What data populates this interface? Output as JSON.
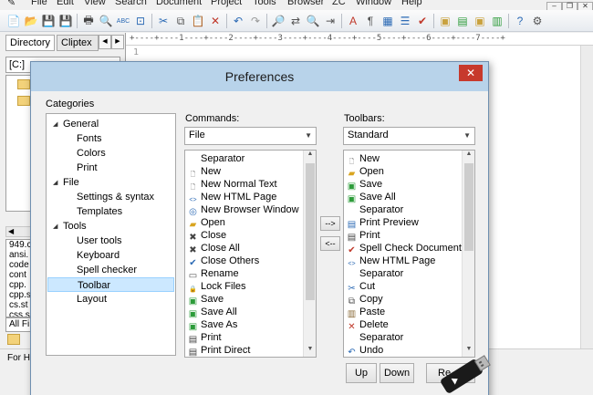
{
  "menu": [
    "File",
    "Edit",
    "View",
    "Search",
    "Document",
    "Project",
    "Tools",
    "Browser",
    "ZC",
    "Window",
    "Help"
  ],
  "window_controls": [
    "–",
    "❐",
    "✕"
  ],
  "left_pane": {
    "tabs": [
      "Directory",
      "Cliptex"
    ],
    "drive": "[C:]",
    "files": [
      "949.c",
      "ansi.",
      "code",
      "cont",
      "cpp.",
      "cpp.s",
      "cs.st",
      "css.s"
    ],
    "filter": "All Fi",
    "status": "For H"
  },
  "editor": {
    "ruler": "+----+----1----+----2----+----3----+----4----+----5----+----6----+----7----+",
    "line_number": "1"
  },
  "dialog": {
    "title": "Preferences",
    "close": "✕",
    "categories_label": "Categories",
    "categories": [
      {
        "label": "General",
        "level": 0,
        "expanded": true
      },
      {
        "label": "Fonts",
        "level": 1
      },
      {
        "label": "Colors",
        "level": 1
      },
      {
        "label": "Print",
        "level": 1
      },
      {
        "label": "File",
        "level": 0,
        "expanded": true
      },
      {
        "label": "Settings & syntax",
        "level": 1
      },
      {
        "label": "Templates",
        "level": 1
      },
      {
        "label": "Tools",
        "level": 0,
        "expanded": true
      },
      {
        "label": "User tools",
        "level": 1
      },
      {
        "label": "Keyboard",
        "level": 1
      },
      {
        "label": "Spell checker",
        "level": 1
      },
      {
        "label": "Toolbar",
        "level": 1,
        "selected": true
      },
      {
        "label": "Layout",
        "level": 1
      }
    ],
    "commands_label": "Commands:",
    "commands_combo": "File",
    "commands": [
      {
        "label": "Separator",
        "icon": ""
      },
      {
        "label": "New",
        "icon": "new-icon"
      },
      {
        "label": "New Normal Text",
        "icon": "new-text-icon"
      },
      {
        "label": "New HTML Page",
        "icon": "html-icon"
      },
      {
        "label": "New Browser Window",
        "icon": "browser-icon"
      },
      {
        "label": "Open",
        "icon": "open-folder-icon"
      },
      {
        "label": "Close",
        "icon": "close-icon"
      },
      {
        "label": "Close All",
        "icon": "close-all-icon"
      },
      {
        "label": "Close Others",
        "icon": "close-others-icon"
      },
      {
        "label": "Rename",
        "icon": "rename-icon"
      },
      {
        "label": "Lock Files",
        "icon": "lock-icon"
      },
      {
        "label": "Save",
        "icon": "save-icon"
      },
      {
        "label": "Save All",
        "icon": "save-all-icon"
      },
      {
        "label": "Save As",
        "icon": "save-as-icon"
      },
      {
        "label": "Print",
        "icon": "print-icon"
      },
      {
        "label": "Print Direct",
        "icon": "print-direct-icon"
      }
    ],
    "add_button": "-->",
    "remove_button": "<--",
    "toolbars_label": "Toolbars:",
    "toolbars_combo": "Standard",
    "toolbar_items": [
      {
        "label": "New",
        "icon": "new-icon"
      },
      {
        "label": "Open",
        "icon": "open-folder-icon"
      },
      {
        "label": "Save",
        "icon": "save-icon"
      },
      {
        "label": "Save All",
        "icon": "save-all-icon"
      },
      {
        "label": "Separator",
        "icon": ""
      },
      {
        "label": "Print Preview",
        "icon": "print-preview-icon"
      },
      {
        "label": "Print",
        "icon": "print-icon"
      },
      {
        "label": "Spell Check Document",
        "icon": "spell-check-icon"
      },
      {
        "label": "New HTML Page",
        "icon": "html-icon"
      },
      {
        "label": "Separator",
        "icon": ""
      },
      {
        "label": "Cut",
        "icon": "cut-icon"
      },
      {
        "label": "Copy",
        "icon": "copy-icon"
      },
      {
        "label": "Paste",
        "icon": "paste-icon"
      },
      {
        "label": "Delete",
        "icon": "delete-icon"
      },
      {
        "label": "Separator",
        "icon": ""
      },
      {
        "label": "Undo",
        "icon": "undo-icon"
      }
    ],
    "up_button": "Up",
    "down_button": "Down",
    "reset_button": "Re"
  }
}
